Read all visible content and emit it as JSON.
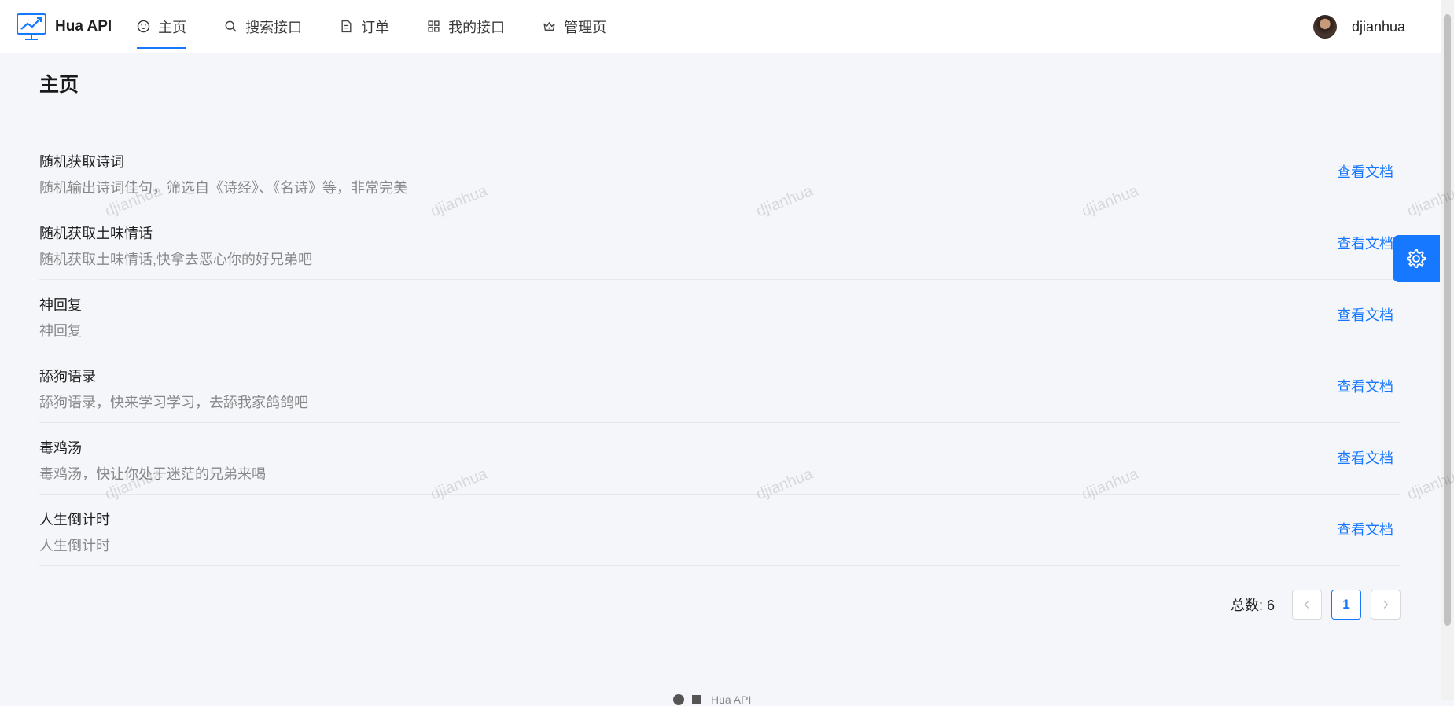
{
  "app": {
    "name": "Hua API"
  },
  "nav": {
    "items": [
      {
        "label": "主页",
        "icon": "smile-icon",
        "active": true
      },
      {
        "label": "搜索接口",
        "icon": "search-icon",
        "active": false
      },
      {
        "label": "订单",
        "icon": "file-text-icon",
        "active": false
      },
      {
        "label": "我的接口",
        "icon": "appstore-icon",
        "active": false
      },
      {
        "label": "管理页",
        "icon": "crown-icon",
        "active": false
      }
    ]
  },
  "user": {
    "name": "djianhua"
  },
  "page": {
    "title": "主页"
  },
  "list": {
    "items": [
      {
        "title": "随机获取诗词",
        "description": "随机输出诗词佳句，筛选自《诗经》、《名诗》等，非常完美",
        "action": "查看文档"
      },
      {
        "title": "随机获取土味情话",
        "description": "随机获取土味情话,快拿去恶心你的好兄弟吧",
        "action": "查看文档"
      },
      {
        "title": "神回复",
        "description": "神回复",
        "action": "查看文档"
      },
      {
        "title": "舔狗语录",
        "description": "舔狗语录，快来学习学习，去舔我家鸽鸽吧",
        "action": "查看文档"
      },
      {
        "title": "毒鸡汤",
        "description": "毒鸡汤，快让你处于迷茫的兄弟来喝",
        "action": "查看文档"
      },
      {
        "title": "人生倒计时",
        "description": "人生倒计时",
        "action": "查看文档"
      }
    ]
  },
  "pagination": {
    "total_label": "总数:",
    "total": "6",
    "current": "1"
  },
  "watermark": {
    "text": "djianhua"
  },
  "footer": {
    "text": "Hua API"
  },
  "colors": {
    "primary": "#1677ff",
    "background": "#f5f6f9"
  }
}
